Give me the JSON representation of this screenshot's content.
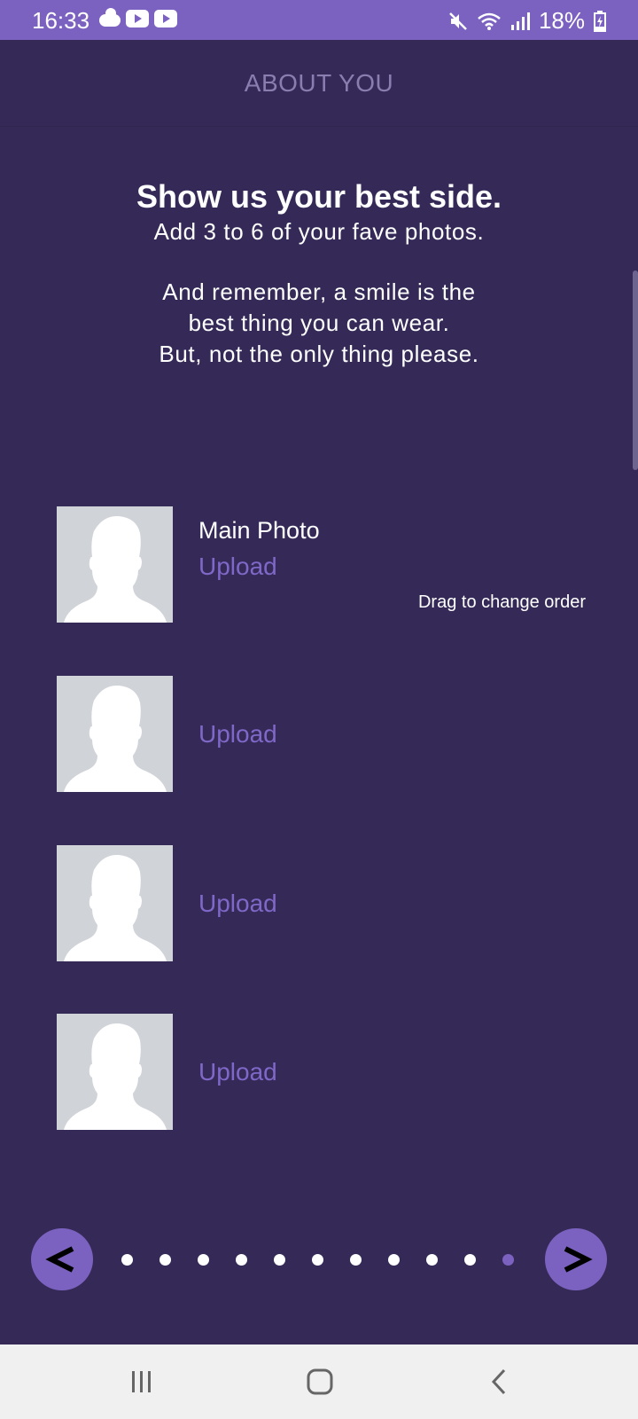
{
  "status_bar": {
    "time": "16:33",
    "battery": "18%",
    "left_icons": [
      "cloud-icon",
      "youtube-icon",
      "youtube-icon"
    ],
    "right_icons": [
      "mute-icon",
      "wifi-icon",
      "signal-icon",
      "battery-charging-icon"
    ]
  },
  "header": {
    "title": "ABOUT YOU"
  },
  "intro": {
    "heading": "Show us your best side.",
    "subheading": "Add 3 to 6 of your fave photos.",
    "line1": "And remember, a smile is the",
    "line2": "best thing you can wear.",
    "line3": "But, not the only thing please."
  },
  "photos": {
    "main_label": "Main Photo",
    "drag_hint": "Drag to change order",
    "items": [
      {
        "upload_label": "Upload"
      },
      {
        "upload_label": "Upload"
      },
      {
        "upload_label": "Upload"
      },
      {
        "upload_label": "Upload"
      }
    ]
  },
  "pager": {
    "prev_label": "<",
    "next_label": ">",
    "total_steps": 11,
    "current_step": 11
  },
  "colors": {
    "background": "#352a57",
    "accent": "#7c62c0",
    "upload_link": "#7f68c8",
    "header_text": "#8a7db0",
    "placeholder": "#d0d3d8"
  },
  "system_nav": {
    "icons": [
      "recent-apps-icon",
      "home-icon",
      "back-icon"
    ]
  }
}
